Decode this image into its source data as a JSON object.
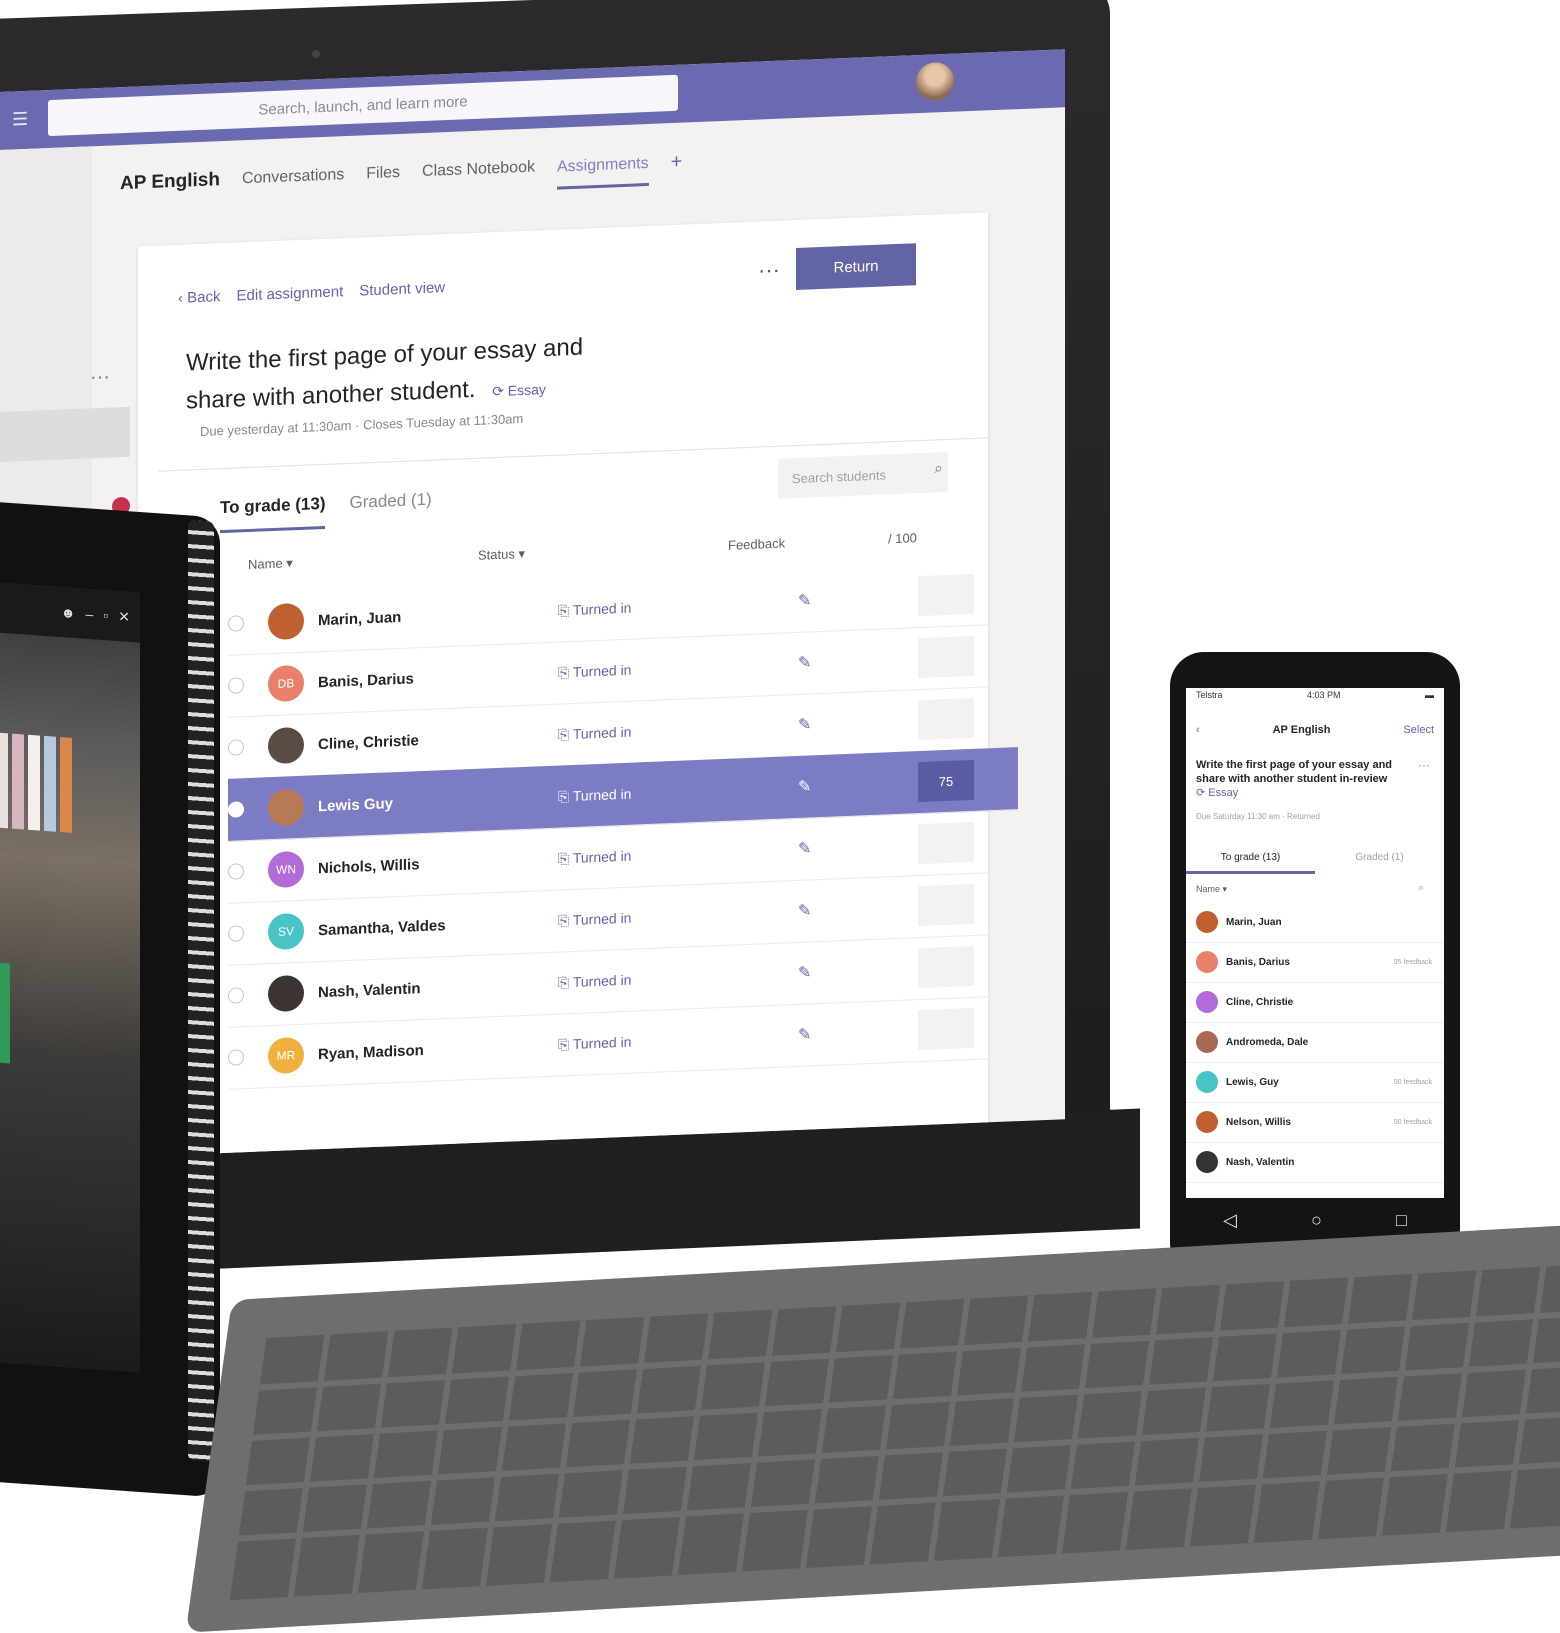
{
  "laptop": {
    "search_placeholder": "Search, launch, and learn more",
    "team_name": "AP English",
    "tabs": [
      "Conversations",
      "Files",
      "Class Notebook",
      "Assignments"
    ],
    "active_tab_index": 3,
    "plus": "+",
    "assignment": {
      "back": "‹ Back",
      "edit": "Edit assignment",
      "student_view": "Student view",
      "more": "···",
      "return_label": "Return",
      "title": "Write the first page of your essay and share with another student.",
      "tag": "⟳ Essay",
      "due": "Due yesterday at 11:30am  ·  Closes Tuesday at 11:30am",
      "tab_to_grade": "To grade (13)",
      "tab_graded": "Graded (1)",
      "search_placeholder": "Search students",
      "columns": {
        "name": "Name ▾",
        "status": "Status ▾",
        "feedback": "Feedback",
        "points": "/ 100"
      },
      "students": [
        {
          "name": "Marin, Juan",
          "status": "Turned in",
          "color": "#c06030",
          "initials": ""
        },
        {
          "name": "Banis, Darius",
          "status": "Turned in",
          "color": "#e8806c",
          "initials": "DB"
        },
        {
          "name": "Cline, Christie",
          "status": "Turned in",
          "color": "#5a4b44",
          "initials": ""
        },
        {
          "name": "Lewis Guy",
          "status": "Turned in",
          "color": "#b87a55",
          "initials": "",
          "selected": true,
          "points": "75"
        },
        {
          "name": "Nichols, Willis",
          "status": "Turned in",
          "color": "#b36bd8",
          "initials": "WN"
        },
        {
          "name": "Samantha, Valdes",
          "status": "Turned in",
          "color": "#46c4c6",
          "initials": "SV"
        },
        {
          "name": "Nash, Valentin",
          "status": "Turned in",
          "color": "#3b3432",
          "initials": ""
        },
        {
          "name": "Ryan, Madison",
          "status": "Turned in",
          "color": "#f0b040",
          "initials": "MR"
        }
      ]
    }
  },
  "tablet": {
    "toolbar_icons": [
      "person-icon",
      "minimize-icon",
      "restore-icon",
      "close-icon"
    ]
  },
  "phone": {
    "time": "4:03 PM",
    "carrier": "Telstra",
    "header_title": "AP English",
    "header_link": "Select",
    "title": "Write the first page of your essay and share with another student in-review",
    "tag": "⟳ Essay",
    "due": "Due Saturday 11:30 am  ·  Returned",
    "tab_to_grade": "To grade (13)",
    "tab_graded": "Graded (1)",
    "sort": "Name ▾",
    "students": [
      {
        "name": "Marin, Juan",
        "right": "",
        "color": "#c06030"
      },
      {
        "name": "Banis, Darius",
        "right": "95\nfeedback",
        "color": "#e8806c"
      },
      {
        "name": "Cline, Christie",
        "right": "",
        "color": "#b36bd8"
      },
      {
        "name": "Andromeda, Dale",
        "right": "",
        "color": "#a86a52"
      },
      {
        "name": "Lewis, Guy",
        "right": "90\nfeedback",
        "color": "#46c4c6"
      },
      {
        "name": "Nelson, Willis",
        "right": "90\nfeedback",
        "color": "#c06030"
      },
      {
        "name": "Nash, Valentin",
        "right": "",
        "color": "#333333"
      }
    ],
    "nav": [
      "◁",
      "○",
      "□"
    ]
  }
}
